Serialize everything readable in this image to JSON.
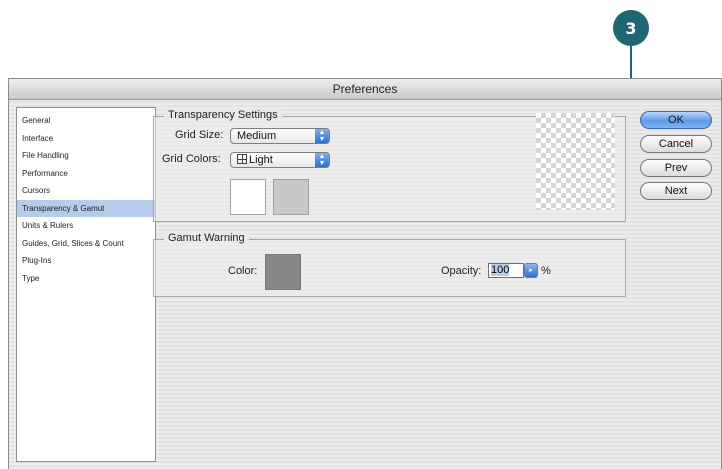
{
  "callout": {
    "number": "3"
  },
  "window": {
    "title": "Preferences"
  },
  "sidebar": {
    "items": [
      {
        "label": "General"
      },
      {
        "label": "Interface"
      },
      {
        "label": "File Handling"
      },
      {
        "label": "Performance"
      },
      {
        "label": "Cursors"
      },
      {
        "label": "Transparency & Gamut",
        "selected": true
      },
      {
        "label": "Units & Rulers"
      },
      {
        "label": "Guides, Grid, Slices & Count"
      },
      {
        "label": "Plug-Ins"
      },
      {
        "label": "Type"
      }
    ]
  },
  "transparency": {
    "title": "Transparency Settings",
    "grid_size_label": "Grid Size:",
    "grid_size_value": "Medium",
    "grid_colors_label": "Grid Colors:",
    "grid_colors_value": "Light",
    "swatch_1_color": "#ffffff",
    "swatch_2_color": "#c8c8c8"
  },
  "gamut": {
    "title": "Gamut Warning",
    "color_label": "Color:",
    "color_swatch": "#888888",
    "opacity_label": "Opacity:",
    "opacity_value": "100",
    "opacity_unit": "%"
  },
  "buttons": {
    "ok": "OK",
    "cancel": "Cancel",
    "prev": "Prev",
    "next": "Next"
  },
  "colors": {
    "callout": "#1f6672",
    "selection": "#b5cdea",
    "aqua_blue": "#2c6fcc"
  }
}
